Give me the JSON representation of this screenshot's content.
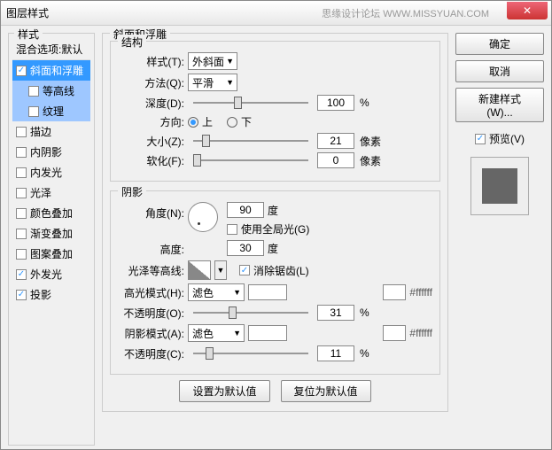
{
  "window": {
    "title": "图层样式"
  },
  "watermark": "思缘设计论坛  WWW.MISSYUAN.COM",
  "sidebar": {
    "header": "样式",
    "blend": "混合选项:默认",
    "items": [
      {
        "label": "斜面和浮雕",
        "checked": true,
        "selected": true
      },
      {
        "label": "等高线",
        "checked": false,
        "sub": true,
        "subsel": true
      },
      {
        "label": "纹理",
        "checked": false,
        "sub": true,
        "subsel": true
      },
      {
        "label": "描边",
        "checked": false
      },
      {
        "label": "内阴影",
        "checked": false
      },
      {
        "label": "内发光",
        "checked": false
      },
      {
        "label": "光泽",
        "checked": false
      },
      {
        "label": "颜色叠加",
        "checked": false
      },
      {
        "label": "渐变叠加",
        "checked": false
      },
      {
        "label": "图案叠加",
        "checked": false
      },
      {
        "label": "外发光",
        "checked": true
      },
      {
        "label": "投影",
        "checked": true
      }
    ]
  },
  "bevel": {
    "title": "斜面和浮雕",
    "structure": {
      "title": "结构",
      "style_label": "样式(T):",
      "style_value": "外斜面",
      "method_label": "方法(Q):",
      "method_value": "平滑",
      "depth_label": "深度(D):",
      "depth_value": "100",
      "depth_unit": "%",
      "dir_label": "方向:",
      "dir_up": "上",
      "dir_down": "下",
      "size_label": "大小(Z):",
      "size_value": "21",
      "size_unit": "像素",
      "soften_label": "软化(F):",
      "soften_value": "0",
      "soften_unit": "像素"
    },
    "shading": {
      "title": "阴影",
      "angle_label": "角度(N):",
      "angle_value": "90",
      "angle_unit": "度",
      "global_label": "使用全局光(G)",
      "alt_label": "高度:",
      "alt_value": "30",
      "alt_unit": "度",
      "gloss_label": "光泽等高线:",
      "aa_label": "消除锯齿(L)",
      "hmode_label": "高光模式(H):",
      "hmode_value": "滤色",
      "hhex": "#ffffff",
      "hopacity_label": "不透明度(O):",
      "hopacity_value": "31",
      "hopacity_unit": "%",
      "smode_label": "阴影模式(A):",
      "smode_value": "滤色",
      "shex": "#ffffff",
      "sopacity_label": "不透明度(C):",
      "sopacity_value": "11",
      "sopacity_unit": "%"
    },
    "default_btn": "设置为默认值",
    "reset_btn": "复位为默认值"
  },
  "right": {
    "ok": "确定",
    "cancel": "取消",
    "newstyle": "新建样式(W)...",
    "preview": "预览(V)"
  }
}
